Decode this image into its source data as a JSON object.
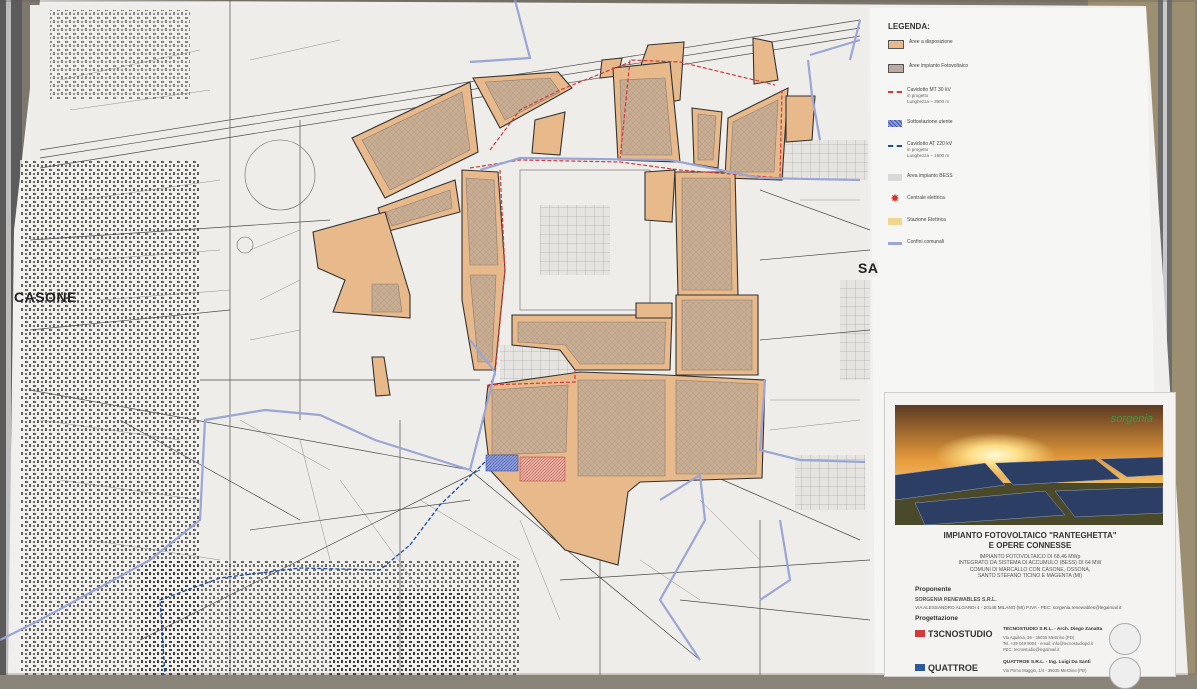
{
  "place_labels": {
    "casone": "CASONE",
    "sa": "SA"
  },
  "legend": {
    "title": "LEGENDA:",
    "items": [
      {
        "label": "Aree a disposizione",
        "color": "#e8b98a",
        "style": "fill"
      },
      {
        "label": "Aree impianto Fotovoltaico",
        "color": "#b8aaa0",
        "style": "fill"
      },
      {
        "label": "Cavidotto MT 30 kV",
        "sub1": "in progetto",
        "sub2": "Lunghezza ~ 3900 m",
        "color": "#d23b3b",
        "style": "dashed"
      },
      {
        "label": "Sottostazione utente",
        "color": "#3f51b5",
        "style": "hatch"
      },
      {
        "label": "Cavidotto AT 220 kV",
        "sub1": "in progetto",
        "sub2": "Lunghezza ~ 1800 m",
        "color": "#1e4fa3",
        "style": "dashed"
      },
      {
        "label": "Area impianto BESS",
        "color": "#d9d9d9",
        "style": "fill"
      },
      {
        "label": "Centrale elettrica",
        "color": "#d8322a",
        "style": "star"
      },
      {
        "label": "Stazione Elettrica",
        "color": "#f2d58e",
        "style": "fill"
      },
      {
        "label": "Confini comunali",
        "color": "#9aa6d6",
        "style": "line"
      }
    ]
  },
  "title_block": {
    "brand": "sorgenia",
    "title_line1": "IMPIANTO FOTOVOLTAICO \"RANTEGHETTA\"",
    "title_line2": "E OPERE CONNESSE",
    "desc1": "IMPIANTO FOTOVOLTAICO DI 68,46 MWp",
    "desc2": "INTEGRATO DA SISTEMA DI ACCUMULO (BESS) DI 64 MW",
    "desc3": "COMUNI DI MARCALLO CON CASONE, OSSONA,",
    "desc4": "SANTO STEFANO TICINO E MAGENTA (MI)",
    "proponent_label": "Proponente",
    "proponent_name": "SORGENIA RENEWABLES S.R.L.",
    "proponent_address": "VIA ALESSANDRO ALGARDI 4 - 20148 MILANO (MI) P.IVA - PEC: sorgenia.renewables@legalmail.it",
    "design_label": "Progettazione",
    "firm1_logo": "T3CNOSTUDIO",
    "firm1_name": "TECNOSTUDIO S.R.L. - Arch. Diego Zanatta",
    "firm1_line1": "Via Aquileia, 36 - 35035 Mestrino (PD)",
    "firm1_line2": "Tel. +39 049 9004 - email: info@tecnostudiopd.it",
    "firm1_line3": "PEC: tecnostudio@legalmail.it",
    "firm2_logo": "QUATTROE",
    "firm2_name": "QUATTROE S.R.L. - Ing. Luigi Da Santi",
    "firm2_line1": "Via Primo Maggio, 1/4 - 35035 Mestrino (PD)"
  }
}
